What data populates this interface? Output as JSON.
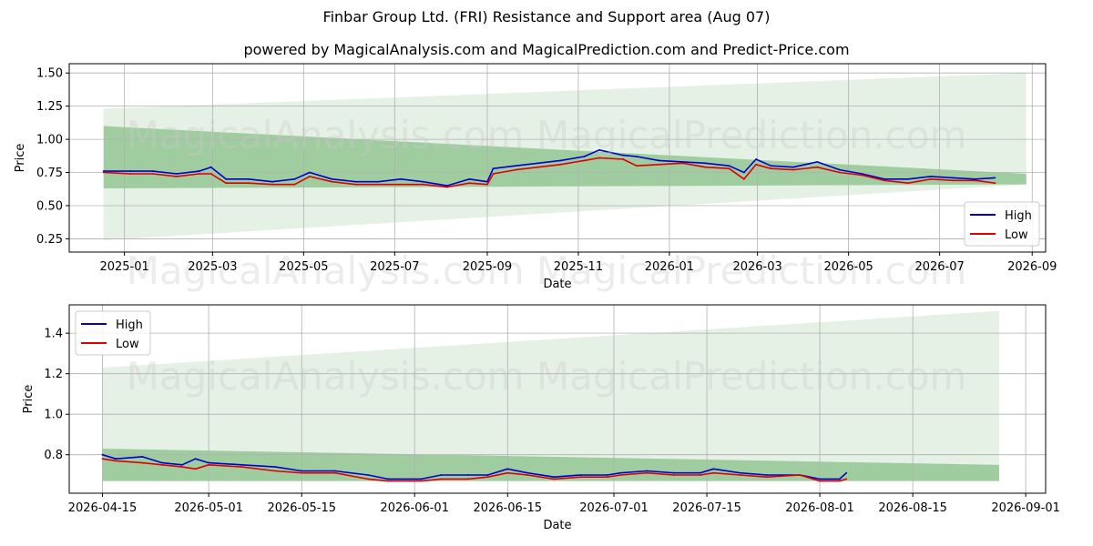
{
  "title": "Finbar Group Ltd. (FRI) Resistance and Support area (Aug 07)",
  "subtitle": "powered by MagicalAnalysis.com and MagicalPrediction.com and Predict-Price.com",
  "watermark": "MagicalAnalysis.com    MagicalPrediction.com",
  "colors": {
    "high": "#0000cc",
    "low": "#dd0000",
    "band_dark": "#8fc48f",
    "band_light": "#dcecdc",
    "grid": "#b0b0b0"
  },
  "chart_data": [
    {
      "type": "line",
      "xlabel": "Date",
      "ylabel": "Price",
      "xlim": [
        "2024-11-25",
        "2026-09-10"
      ],
      "ylim": [
        0.15,
        1.57
      ],
      "x_ticks": [
        "2025-01",
        "2025-03",
        "2025-05",
        "2025-07",
        "2025-09",
        "2025-11",
        "2026-01",
        "2026-03",
        "2026-05",
        "2026-07",
        "2026-09"
      ],
      "x_tick_dates": [
        "2025-01-01",
        "2025-03-01",
        "2025-05-01",
        "2025-07-01",
        "2025-09-01",
        "2025-11-01",
        "2026-01-01",
        "2026-03-01",
        "2026-05-01",
        "2026-07-01",
        "2026-09-01"
      ],
      "y_ticks": [
        "0.25",
        "0.50",
        "0.75",
        "1.00",
        "1.25",
        "1.50"
      ],
      "y_tick_values": [
        0.25,
        0.5,
        0.75,
        1.0,
        1.25,
        1.5
      ],
      "legend": {
        "position": "lower-right",
        "entries": [
          "High",
          "Low"
        ]
      },
      "grid": true,
      "bands": [
        {
          "x": [
            "2024-12-18",
            "2026-08-28"
          ],
          "upper": [
            1.23,
            1.5
          ],
          "lower": [
            0.24,
            0.66
          ],
          "shade": "light"
        },
        {
          "x": [
            "2024-12-18",
            "2026-08-28"
          ],
          "upper": [
            1.1,
            0.74
          ],
          "lower": [
            0.63,
            0.66
          ],
          "shade": "dark"
        }
      ],
      "series": [
        {
          "name": "High",
          "x": [
            "2024-12-18",
            "2025-01-05",
            "2025-01-20",
            "2025-02-05",
            "2025-02-20",
            "2025-02-28",
            "2025-03-10",
            "2025-03-25",
            "2025-04-10",
            "2025-04-25",
            "2025-05-05",
            "2025-05-20",
            "2025-06-05",
            "2025-06-20",
            "2025-07-05",
            "2025-07-20",
            "2025-08-05",
            "2025-08-20",
            "2025-09-01",
            "2025-09-05",
            "2025-09-20",
            "2025-10-05",
            "2025-10-20",
            "2025-11-05",
            "2025-11-15",
            "2025-12-01",
            "2025-12-10",
            "2025-12-25",
            "2026-01-10",
            "2026-01-25",
            "2026-02-10",
            "2026-02-20",
            "2026-02-28",
            "2026-03-10",
            "2026-03-25",
            "2026-04-10",
            "2026-04-25",
            "2026-05-10",
            "2026-05-25",
            "2026-06-10",
            "2026-06-25",
            "2026-07-10",
            "2026-07-25",
            "2026-08-07"
          ],
          "values": [
            0.76,
            0.76,
            0.76,
            0.74,
            0.76,
            0.79,
            0.7,
            0.7,
            0.68,
            0.7,
            0.75,
            0.7,
            0.68,
            0.68,
            0.7,
            0.68,
            0.65,
            0.7,
            0.68,
            0.78,
            0.8,
            0.82,
            0.84,
            0.87,
            0.92,
            0.88,
            0.87,
            0.84,
            0.83,
            0.82,
            0.8,
            0.75,
            0.85,
            0.8,
            0.79,
            0.83,
            0.77,
            0.74,
            0.7,
            0.7,
            0.72,
            0.71,
            0.7,
            0.71
          ]
        },
        {
          "name": "Low",
          "x": [
            "2024-12-18",
            "2025-01-05",
            "2025-01-20",
            "2025-02-05",
            "2025-02-20",
            "2025-02-28",
            "2025-03-10",
            "2025-03-25",
            "2025-04-10",
            "2025-04-25",
            "2025-05-05",
            "2025-05-20",
            "2025-06-05",
            "2025-06-20",
            "2025-07-05",
            "2025-07-20",
            "2025-08-05",
            "2025-08-20",
            "2025-09-01",
            "2025-09-05",
            "2025-09-20",
            "2025-10-05",
            "2025-10-20",
            "2025-11-05",
            "2025-11-15",
            "2025-12-01",
            "2025-12-10",
            "2025-12-25",
            "2026-01-10",
            "2026-01-25",
            "2026-02-10",
            "2026-02-20",
            "2026-02-28",
            "2026-03-10",
            "2026-03-25",
            "2026-04-10",
            "2026-04-25",
            "2026-05-10",
            "2026-05-25",
            "2026-06-10",
            "2026-06-25",
            "2026-07-10",
            "2026-07-25",
            "2026-08-07"
          ],
          "values": [
            0.75,
            0.74,
            0.74,
            0.72,
            0.74,
            0.74,
            0.67,
            0.67,
            0.66,
            0.66,
            0.72,
            0.68,
            0.66,
            0.66,
            0.66,
            0.66,
            0.64,
            0.67,
            0.66,
            0.74,
            0.77,
            0.79,
            0.81,
            0.84,
            0.86,
            0.85,
            0.8,
            0.81,
            0.82,
            0.79,
            0.78,
            0.7,
            0.81,
            0.78,
            0.77,
            0.79,
            0.75,
            0.73,
            0.69,
            0.67,
            0.7,
            0.69,
            0.69,
            0.67
          ]
        }
      ]
    },
    {
      "type": "line",
      "xlabel": "Date",
      "ylabel": "Price",
      "xlim": [
        "2026-04-10",
        "2026-09-04"
      ],
      "ylim": [
        0.61,
        1.54
      ],
      "x_ticks": [
        "2026-04-15",
        "2026-05-01",
        "2026-05-15",
        "2026-06-01",
        "2026-06-15",
        "2026-07-01",
        "2026-07-15",
        "2026-08-01",
        "2026-08-15",
        "2026-09-01"
      ],
      "x_tick_dates": [
        "2026-04-15",
        "2026-05-01",
        "2026-05-15",
        "2026-06-01",
        "2026-06-15",
        "2026-07-01",
        "2026-07-15",
        "2026-08-01",
        "2026-08-15",
        "2026-09-01"
      ],
      "y_ticks": [
        "0.8",
        "1.0",
        "1.2",
        "1.4"
      ],
      "y_tick_values": [
        0.8,
        1.0,
        1.2,
        1.4
      ],
      "legend": {
        "position": "upper-left",
        "entries": [
          "High",
          "Low"
        ]
      },
      "grid": true,
      "bands": [
        {
          "x": [
            "2026-04-15",
            "2026-08-28"
          ],
          "upper": [
            1.23,
            1.51
          ],
          "lower": [
            0.67,
            0.67
          ],
          "shade": "light"
        },
        {
          "x": [
            "2026-04-15",
            "2026-08-28"
          ],
          "upper": [
            0.83,
            0.75
          ],
          "lower": [
            0.67,
            0.67
          ],
          "shade": "dark"
        }
      ],
      "series": [
        {
          "name": "High",
          "x": [
            "2026-04-15",
            "2026-04-17",
            "2026-04-21",
            "2026-04-24",
            "2026-04-27",
            "2026-04-29",
            "2026-05-01",
            "2026-05-06",
            "2026-05-11",
            "2026-05-15",
            "2026-05-20",
            "2026-05-25",
            "2026-05-28",
            "2026-06-02",
            "2026-06-05",
            "2026-06-09",
            "2026-06-12",
            "2026-06-15",
            "2026-06-18",
            "2026-06-22",
            "2026-06-26",
            "2026-06-30",
            "2026-07-02",
            "2026-07-06",
            "2026-07-10",
            "2026-07-14",
            "2026-07-16",
            "2026-07-20",
            "2026-07-24",
            "2026-07-29",
            "2026-08-01",
            "2026-08-04",
            "2026-08-05"
          ],
          "values": [
            0.8,
            0.78,
            0.79,
            0.76,
            0.75,
            0.78,
            0.76,
            0.75,
            0.74,
            0.72,
            0.72,
            0.7,
            0.68,
            0.68,
            0.7,
            0.7,
            0.7,
            0.73,
            0.71,
            0.69,
            0.7,
            0.7,
            0.71,
            0.72,
            0.71,
            0.71,
            0.73,
            0.71,
            0.7,
            0.7,
            0.68,
            0.68,
            0.71
          ]
        },
        {
          "name": "Low",
          "x": [
            "2026-04-15",
            "2026-04-17",
            "2026-04-21",
            "2026-04-24",
            "2026-04-27",
            "2026-04-29",
            "2026-05-01",
            "2026-05-06",
            "2026-05-11",
            "2026-05-15",
            "2026-05-20",
            "2026-05-25",
            "2026-05-28",
            "2026-06-02",
            "2026-06-05",
            "2026-06-09",
            "2026-06-12",
            "2026-06-15",
            "2026-06-18",
            "2026-06-22",
            "2026-06-26",
            "2026-06-30",
            "2026-07-02",
            "2026-07-06",
            "2026-07-10",
            "2026-07-14",
            "2026-07-16",
            "2026-07-20",
            "2026-07-24",
            "2026-07-29",
            "2026-08-01",
            "2026-08-04",
            "2026-08-05"
          ],
          "values": [
            0.78,
            0.77,
            0.76,
            0.75,
            0.74,
            0.73,
            0.75,
            0.74,
            0.72,
            0.71,
            0.71,
            0.68,
            0.67,
            0.67,
            0.68,
            0.68,
            0.69,
            0.71,
            0.7,
            0.68,
            0.69,
            0.69,
            0.7,
            0.71,
            0.7,
            0.7,
            0.71,
            0.7,
            0.69,
            0.7,
            0.67,
            0.67,
            0.68
          ]
        }
      ]
    }
  ]
}
